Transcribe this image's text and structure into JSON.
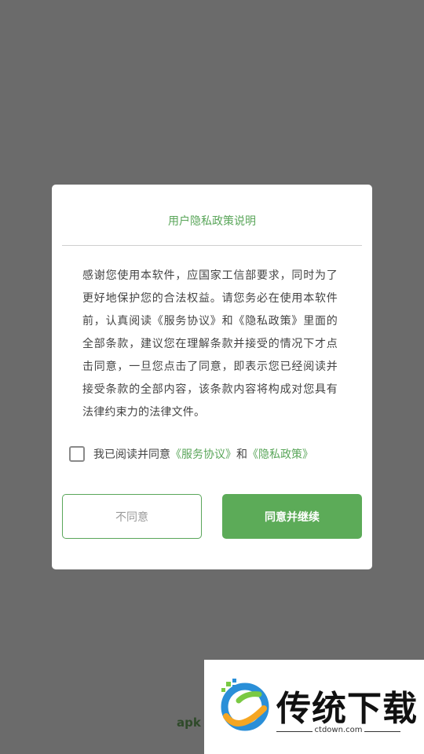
{
  "dialog": {
    "title": "用户隐私政策说明",
    "body": "感谢您使用本软件，应国家工信部要求，同时为了更好地保护您的合法权益。请您务必在使用本软件前，认真阅读《服务协议》和《隐私政策》里面的全部条款，建议您在理解条款并接受的情况下才点击同意，一旦您点击了同意，即表示您已经阅读并接受条款的全部内容，该条款内容将构成对您具有法律约束力的法律文件。",
    "agree_prefix": "我已阅读并同意",
    "service_link": "《服务协议》",
    "and": "和",
    "privacy_link": "《隐私政策》",
    "checkbox_checked": false,
    "disagree_label": "不同意",
    "agree_label": "同意并继续"
  },
  "background_text": "apk",
  "watermark": {
    "title": "传统下载",
    "url": "ctdown.com"
  },
  "colors": {
    "accent": "#5aa65a",
    "overlay": "#6b6b6b"
  }
}
